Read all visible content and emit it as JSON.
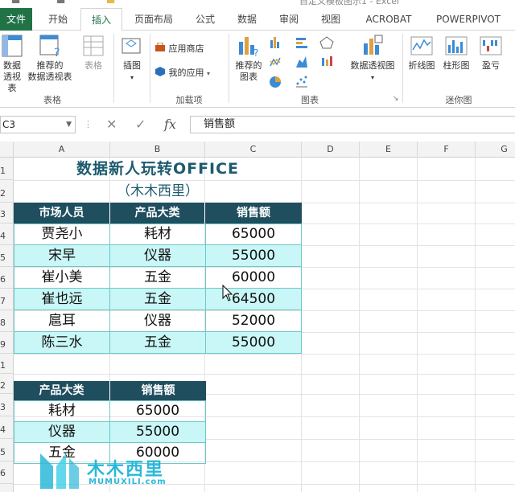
{
  "window": {
    "title_fragment": "自定义模板图示1 - Excel"
  },
  "tabs": [
    {
      "label": "文件",
      "kind": "file"
    },
    {
      "label": "开始",
      "kind": "normal"
    },
    {
      "label": "插入",
      "kind": "active"
    },
    {
      "label": "页面布局",
      "kind": "normal"
    },
    {
      "label": "公式",
      "kind": "normal"
    },
    {
      "label": "数据",
      "kind": "normal"
    },
    {
      "label": "审阅",
      "kind": "normal"
    },
    {
      "label": "视图",
      "kind": "normal"
    },
    {
      "label": "ACROBAT",
      "kind": "normal"
    },
    {
      "label": "POWERPIVOT",
      "kind": "normal"
    }
  ],
  "ribbon": {
    "tables": {
      "pivot_label_line1": "数据",
      "pivot_label_line2": "透视表",
      "recommended_line1": "推荐的",
      "recommended_line2": "数据透视表",
      "table_label": "表格",
      "group_label": "表格"
    },
    "illustrations": {
      "label": "插图"
    },
    "addins": {
      "store_label": "应用商店",
      "myapps_label": "我的应用",
      "group_label": "加载项"
    },
    "charts": {
      "recommended_line1": "推荐的",
      "recommended_line2": "图表",
      "pivot_chart_label": "数据透视图",
      "group_label": "图表"
    },
    "sparklines": {
      "line_label": "折线图",
      "column_label": "柱形图",
      "winloss_label": "盈亏",
      "group_label": "迷你图"
    }
  },
  "formula_bar": {
    "name_box": "C3",
    "content": "销售额"
  },
  "grid": {
    "columns": [
      "A",
      "B",
      "C",
      "D",
      "E",
      "F",
      "G"
    ],
    "rows": [
      "1",
      "2",
      "3",
      "4",
      "5",
      "6",
      "7",
      "8",
      "9",
      "1",
      "2",
      "3",
      "4",
      "5",
      "6"
    ]
  },
  "sheet": {
    "title": "数据新人玩转OFFICE",
    "subtitle": "（木木西里）",
    "table1": {
      "headers": [
        "市场人员",
        "产品大类",
        "销售额"
      ],
      "rows": [
        [
          "贾尧小",
          "耗材",
          "65000"
        ],
        [
          "宋早",
          "仪器",
          "55000"
        ],
        [
          "崔小美",
          "五金",
          "60000"
        ],
        [
          "崔也远",
          "五金",
          "64500"
        ],
        [
          "扈耳",
          "仪器",
          "52000"
        ],
        [
          "陈三水",
          "五金",
          "55000"
        ]
      ]
    },
    "table2": {
      "headers": [
        "产品大类",
        "销售额"
      ],
      "rows": [
        [
          "耗材",
          "65000"
        ],
        [
          "仪器",
          "55000"
        ],
        [
          "五金",
          "60000"
        ]
      ]
    }
  },
  "watermark": {
    "line1": "木木西里",
    "line2": "MUMUXILI.com"
  },
  "colors": {
    "excel_green": "#217346",
    "header_fill": "#1f4e5f",
    "band_fill": "#c9f6f6",
    "title_color": "#1d5a6e",
    "watermark": "#2ab8d8"
  }
}
